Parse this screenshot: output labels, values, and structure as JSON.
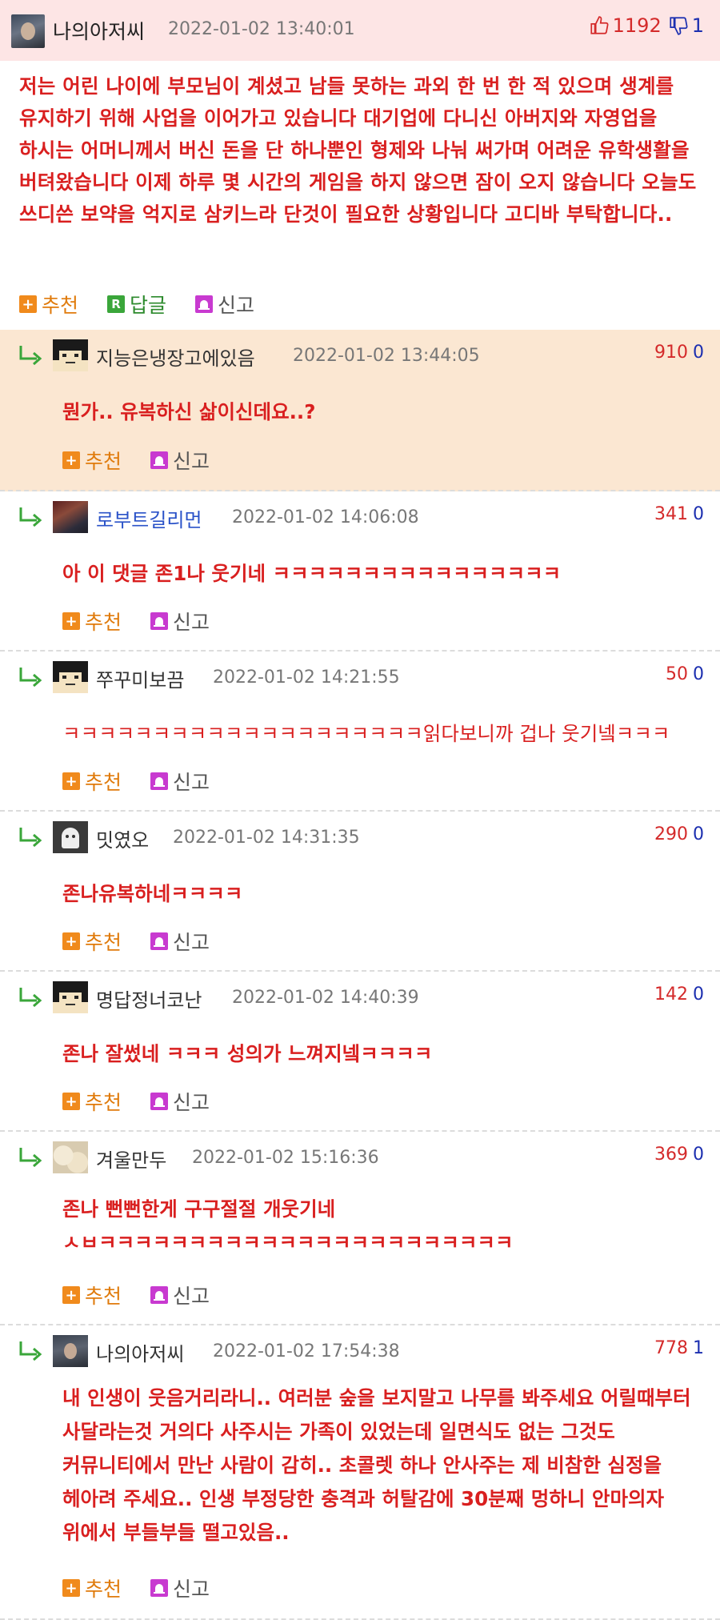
{
  "post": {
    "author": "나의아저씨",
    "date": "2022-01-02 13:40:01",
    "upvotes": "1192",
    "downvotes": "1",
    "body": "저는 어린 나이에 부모님이 계셨고 남들 못하는 과외 한 번 한 적 있으며 생계를 유지하기 위해 사업을 이어가고 있습니다 대기업에 다니신 아버지와 자영업을 하시는 어머니께서 버신 돈을 단 하나뿐인 형제와 나눠 써가며 어려운 유학생활을 버텨왔습니다 이제 하루 몇 시간의 게임을 하지 않으면 잠이 오지 않습니다 오늘도 쓰디쓴 보약을 억지로 삼키느라 단것이 필요한 상황입니다 고디바 부탁합니다..",
    "actions": {
      "recommend": "추천",
      "reply": "답글",
      "report": "신고"
    },
    "reply_icon": "R",
    "plus_icon": "+"
  },
  "comments": [
    {
      "author": "지능은냉장고에있음",
      "date": "2022-01-02 13:44:05",
      "up": "910",
      "down": "0",
      "text": "뭔가.. 유복하신 삶이신데요..?"
    },
    {
      "author": "로부트길리먼",
      "date": "2022-01-02 14:06:08",
      "up": "341",
      "down": "0",
      "text": "아 이 댓글 존1나 웃기네 ㅋㅋㅋㅋㅋㅋㅋㅋㅋㅋㅋㅋㅋㅋㅋㅋ"
    },
    {
      "author": "쭈꾸미보끔",
      "date": "2022-01-02 14:21:55",
      "up": "50",
      "down": "0",
      "text": "ㅋㅋㅋㅋㅋㅋㅋㅋㅋㅋㅋㅋㅋㅋㅋㅋㅋㅋㅋㅋ읽다보니까 겁나 웃기넼ㅋㅋㅋ"
    },
    {
      "author": "밋였오",
      "date": "2022-01-02 14:31:35",
      "up": "290",
      "down": "0",
      "text": "존나유복하네ㅋㅋㅋㅋ"
    },
    {
      "author": "명답정너코난",
      "date": "2022-01-02 14:40:39",
      "up": "142",
      "down": "0",
      "text": "존나 잘썼네 ㅋㅋㅋ 성의가 느껴지넼ㅋㅋㅋㅋ"
    },
    {
      "author": "겨울만두",
      "date": "2022-01-02 15:16:36",
      "up": "369",
      "down": "0",
      "text": "존나 뻔뻔한게 구구절절 개웃기네 ㅅㅂㅋㅋㅋㅋㅋㅋㅋㅋㅋㅋㅋㅋㅋㅋㅋㅋㅋㅋㅋㅋㅋㅋㅋ"
    },
    {
      "author": "나의아저씨",
      "date": "2022-01-02 17:54:38",
      "up": "778",
      "down": "1",
      "text": "내 인생이 웃음거리라니.. 여러분 숲을 보지말고 나무를 봐주세요 어릴때부터 사달라는것 거의다 사주시는 가족이 있었는데 일면식도 없는 그것도 커뮤니티에서 만난 사람이 감히.. 초콜렛 하나 안사주는 제 비참한 심정을 헤아려 주세요.. 인생 부정당한 충격과 허탈감에 30분째 멍하니 안마의자 위에서 부들부들 떨고있음.."
    }
  ],
  "comment_actions": {
    "recommend": "추천",
    "report": "신고"
  },
  "colors": {
    "post_header_bg": "#fde5e5",
    "highlight_comment_bg": "#fbe7d2",
    "body_text": "#d91f1f",
    "upvote": "#d42a2a",
    "downvote": "#1c2fb0",
    "recommend": "#e07b0c"
  }
}
